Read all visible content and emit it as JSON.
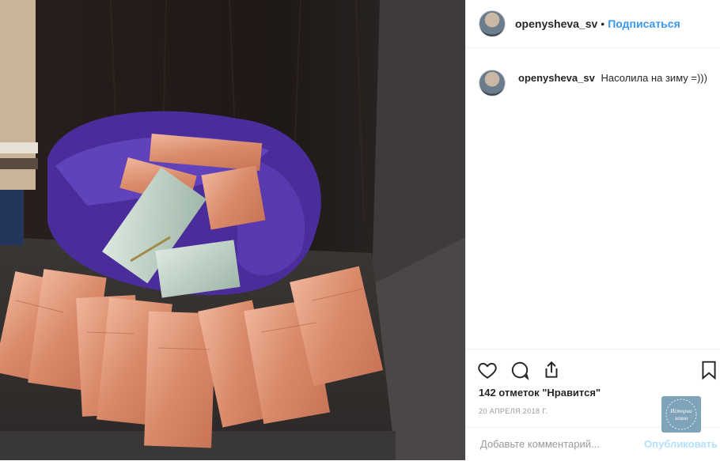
{
  "header": {
    "username": "openysheva_sv",
    "dot": "•",
    "follow_label": "Подписаться"
  },
  "caption": {
    "username": "openysheva_sv",
    "text": "Насолила на зиму =)))"
  },
  "actions": {
    "like_icon": "heart-icon",
    "comment_icon": "speech-bubble-icon",
    "share_icon": "share-arrow-icon",
    "save_icon": "bookmark-icon"
  },
  "likes_text": "142 отметок \"Нравится\"",
  "date_text": "20 АПРЕЛЯ 2018 Г.",
  "add_comment": {
    "placeholder": "Добавьте комментарий...",
    "publish_label": "Опубликовать"
  },
  "photo": {
    "subject": "banknote-bundles-photo"
  },
  "watermark": {
    "line1": "Истории",
    "line2": "земли"
  },
  "colors": {
    "link_blue": "#3897f0",
    "publish_disabled": "#b2dffc",
    "bag_purple": "#4a2c9a",
    "banknote_orange": "#d98a6a"
  }
}
